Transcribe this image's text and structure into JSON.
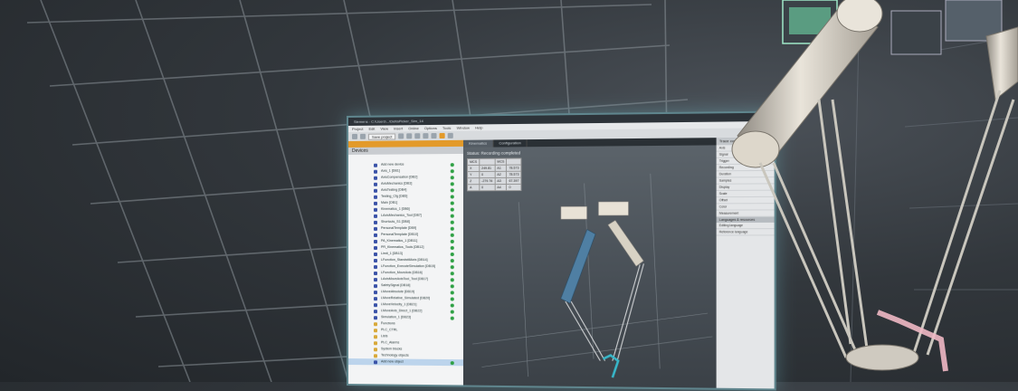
{
  "window": {
    "title": "Siemens - C:\\Users\\...\\DeltaPicker_Sim_14",
    "menu": [
      "Project",
      "Edit",
      "View",
      "Insert",
      "Online",
      "Options",
      "Tools",
      "Window",
      "Help"
    ],
    "toolbar": {
      "save_label": "Save project"
    },
    "tree": {
      "title": "Devices",
      "items": [
        {
          "label": "Add new device"
        },
        {
          "label": "Axis_1 [DB1]"
        },
        {
          "label": "AxisCompensation [DB2]"
        },
        {
          "label": "AxisMechanics [DB3]"
        },
        {
          "label": "AxisTesting [DB4]"
        },
        {
          "label": "Testing_Cfg [DB5]"
        },
        {
          "label": "Main [OB1]"
        },
        {
          "label": "Kinematics_1 [DB6]"
        },
        {
          "label": "LAxisMechanics_Tool [DB7]"
        },
        {
          "label": "Shortcuts_S1 [DB8]"
        },
        {
          "label": "PersonalTemplate [DB9]"
        },
        {
          "label": "PersonalTemplate [DB10]"
        },
        {
          "label": "PA_Kinematics_1 [DB11]"
        },
        {
          "label": "PR_Kinematics_Tools [DB12]"
        },
        {
          "label": "Limit_1 [DB13]"
        },
        {
          "label": "LFunction_StandstillAxis [DB14]"
        },
        {
          "label": "LFunction_ExecuteSimulation [DB15]"
        },
        {
          "label": "LFunction_MoveAxis [DB16]"
        },
        {
          "label": "LAxisMoveAxisTool_Tool [DB17]"
        },
        {
          "label": "SafetySignal [DB18]"
        },
        {
          "label": "LMoveAbsolute [DB19]"
        },
        {
          "label": "LMoveRelative_Simulated [DB20]"
        },
        {
          "label": "LMoveVelocity_1 [DB21]"
        },
        {
          "label": "LMoveAxis_Direct_1 [DB22]"
        },
        {
          "label": "Simulation_1 [DB23]"
        },
        {
          "label": "Functions",
          "folder": true
        },
        {
          "label": "PLC_CTRL",
          "folder": true
        },
        {
          "label": "Lists",
          "folder": true
        },
        {
          "label": "PLC_Alarms",
          "folder": true
        },
        {
          "label": "System blocks",
          "folder": true
        },
        {
          "label": "Technology objects",
          "folder": true
        },
        {
          "label": "Add new object",
          "selected": true
        }
      ]
    },
    "viewport": {
      "tabs": [
        "Kinematics",
        "Configuration"
      ],
      "status": "Status: Recording completed",
      "coords": [
        [
          "MCS",
          "",
          "MCS",
          ""
        ],
        [
          "X",
          "249.81",
          "A1",
          "78.573"
        ],
        [
          "Y",
          "0",
          "A2",
          "78.573"
        ],
        [
          "Z",
          "-279.76",
          "A3",
          "67.397"
        ],
        [
          "A",
          "0",
          "A4",
          "0"
        ]
      ]
    },
    "properties": {
      "title": "Trace configuration",
      "rows": [
        "Axis",
        "Signal",
        "Trigger",
        "Recording",
        "Duration",
        "Samples",
        "Display",
        "Scale",
        "Offset",
        "Color",
        "Measurement"
      ],
      "lang_title": "Languages & resources",
      "lang_rows": [
        "Editing language",
        "Reference language"
      ]
    }
  }
}
